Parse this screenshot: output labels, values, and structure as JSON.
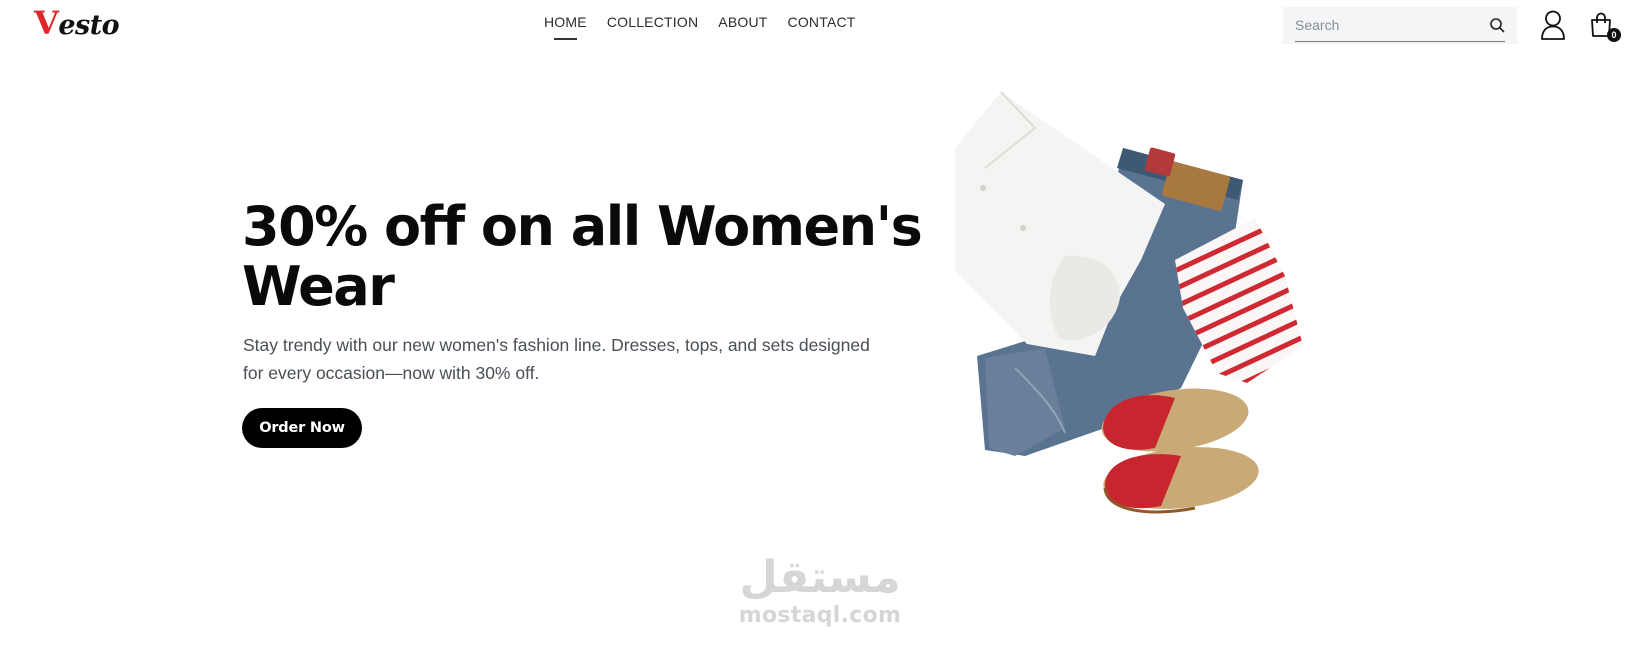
{
  "brand": {
    "logo_initial": "V",
    "logo_rest": "esto",
    "accent_color": "#e0262b"
  },
  "nav": {
    "items": [
      {
        "label": "HOME"
      },
      {
        "label": "COLLECTION"
      },
      {
        "label": "ABOUT"
      },
      {
        "label": "CONTACT"
      }
    ]
  },
  "search": {
    "placeholder": "Search",
    "value": ""
  },
  "cart": {
    "count": "0"
  },
  "hero": {
    "title": "30% off on all Women's Wear",
    "description": "Stay trendy with our new women's fashion line. Dresses, tops, and sets designed for every occasion—now with 30% off.",
    "cta_label": "Order Now"
  },
  "watermark": {
    "arabic": "مستقل",
    "latin": "mostaql.com"
  },
  "icons": {
    "search": "search-icon",
    "user": "user-icon",
    "cart": "shopping-bag-icon"
  }
}
